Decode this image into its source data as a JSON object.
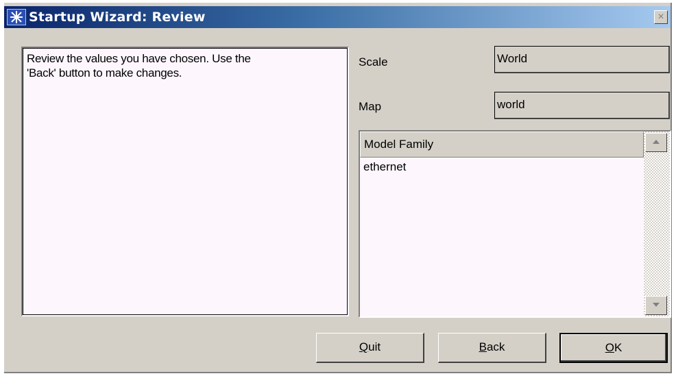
{
  "window": {
    "title": "Startup Wizard: Review",
    "close_symbol": "×",
    "icon": "wizard-star-icon"
  },
  "description": {
    "line1": "Review the values you have chosen. Use the",
    "line2": "'Back' button to make changes."
  },
  "fields": {
    "scale": {
      "label": "Scale",
      "value": "World"
    },
    "map": {
      "label": "Map",
      "value": "world"
    }
  },
  "model_family": {
    "header": "Model Family",
    "items": [
      "ethernet"
    ]
  },
  "buttons": {
    "quit": {
      "mnemonic": "Q",
      "rest": "uit"
    },
    "back": {
      "mnemonic": "B",
      "rest": "ack"
    },
    "ok": {
      "mnemonic": "O",
      "rest": "K"
    }
  },
  "colors": {
    "title_start": "#0a246a",
    "title_end": "#a6caf0",
    "face": "#d4d0c8",
    "panel_bg": "#fdf7fd"
  }
}
